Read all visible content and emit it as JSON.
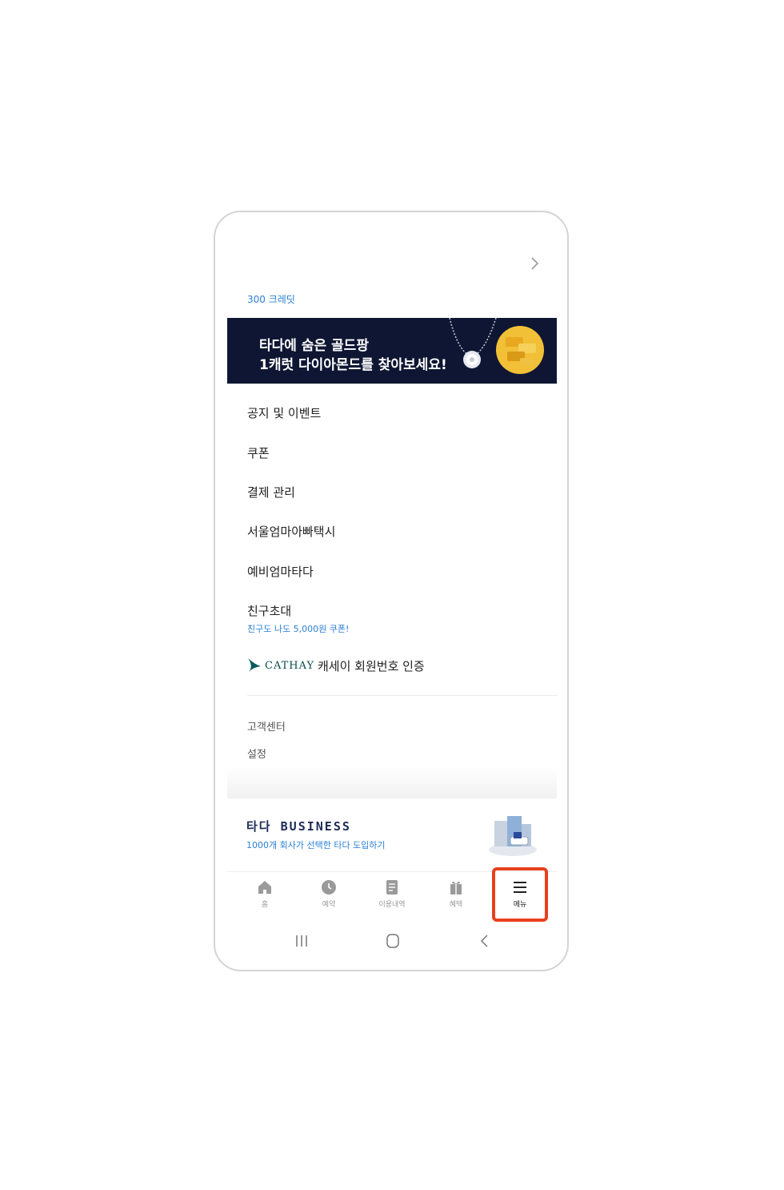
{
  "credits": "300 크레딧",
  "banner": {
    "line1": "타다에 숨은 골드팡",
    "line2": "1캐럿 다이아몬드를 찾아보세요!"
  },
  "menu": {
    "items": [
      "공지 및 이벤트",
      "쿠폰",
      "결제 관리",
      "서울엄마아빠택시",
      "예비엄마타다",
      "친구초대"
    ],
    "invite_sub": "친구도 나도 5,000원 쿠폰!",
    "cathay_logo": "CATHAY",
    "cathay_label": "캐세이 회원번호 인증"
  },
  "secondary": {
    "support": "고객센터",
    "settings": "설정"
  },
  "business": {
    "brand": "타다 BUSINESS",
    "tagline": "1000개 회사가 선택한 타다 도입하기"
  },
  "tabs": [
    {
      "label": "홈",
      "icon": "home-icon"
    },
    {
      "label": "예약",
      "icon": "clock-icon"
    },
    {
      "label": "이용내역",
      "icon": "document-icon"
    },
    {
      "label": "혜택",
      "icon": "gift-icon"
    },
    {
      "label": "메뉴",
      "icon": "hamburger-icon"
    }
  ],
  "colors": {
    "accent_blue": "#2b7fd4",
    "banner_bg": "#0e1633",
    "highlight": "#e8401c"
  }
}
